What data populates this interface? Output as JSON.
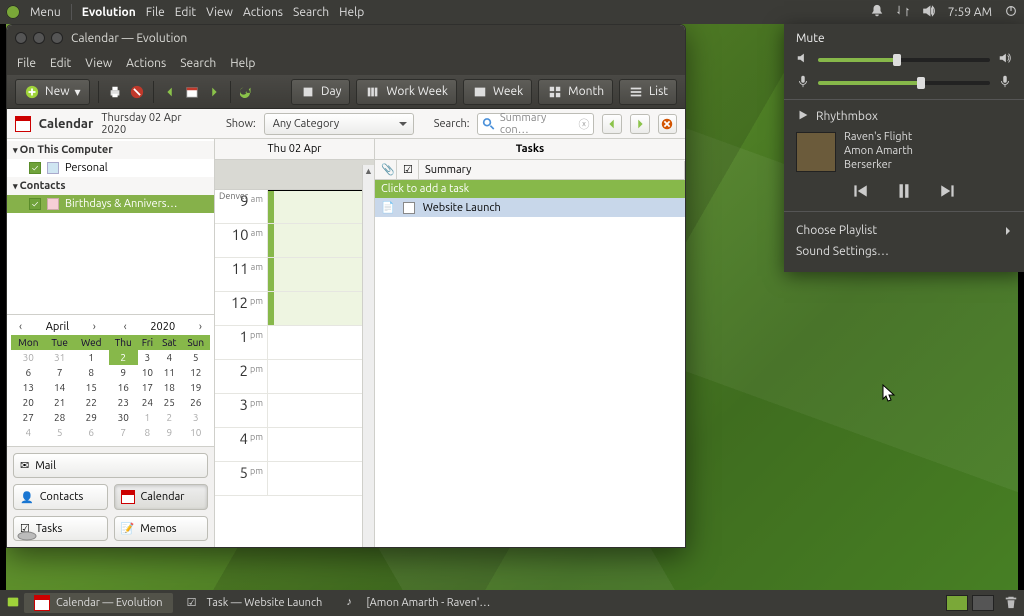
{
  "top_panel": {
    "menu": "Menu",
    "app": "Evolution",
    "items": [
      "File",
      "Edit",
      "View",
      "Actions",
      "Search",
      "Help"
    ],
    "time": "7:59 AM"
  },
  "volume_popover": {
    "mute": "Mute",
    "output_pct": 46,
    "input_pct": 60,
    "player": "Rhythmbox",
    "track": "Raven's Flight",
    "artist": "Amon Amarth",
    "album": "Berserker",
    "choose_playlist": "Choose Playlist",
    "sound_settings": "Sound Settings…"
  },
  "window": {
    "title": "Calendar — Evolution",
    "menubar": [
      "File",
      "Edit",
      "View",
      "Actions",
      "Search",
      "Help"
    ],
    "new_label": "New",
    "views": {
      "day": "Day",
      "work_week": "Work Week",
      "week": "Week",
      "month": "Month",
      "list": "List"
    }
  },
  "filter": {
    "heading": "Calendar",
    "date": "Thursday 02 Apr 2020",
    "show_label": "Show:",
    "category": "Any Category",
    "search_label": "Search:",
    "search_placeholder": "Summary con…"
  },
  "tree": {
    "computer": "On This Computer",
    "personal": "Personal",
    "contacts": "Contacts",
    "birthdays": "Birthdays & Annivers…"
  },
  "minical": {
    "month": "April",
    "year": "2020",
    "dow": [
      "Mon",
      "Tue",
      "Wed",
      "Thu",
      "Fri",
      "Sat",
      "Sun"
    ],
    "weeks": [
      [
        {
          "d": 30,
          "dim": true
        },
        {
          "d": 31,
          "dim": true
        },
        {
          "d": 1
        },
        {
          "d": 2,
          "today": true
        },
        {
          "d": 3
        },
        {
          "d": 4
        },
        {
          "d": 5
        }
      ],
      [
        {
          "d": 6
        },
        {
          "d": 7
        },
        {
          "d": 8
        },
        {
          "d": 9
        },
        {
          "d": 10
        },
        {
          "d": 11
        },
        {
          "d": 12
        }
      ],
      [
        {
          "d": 13
        },
        {
          "d": 14
        },
        {
          "d": 15
        },
        {
          "d": 16
        },
        {
          "d": 17
        },
        {
          "d": 18
        },
        {
          "d": 19
        }
      ],
      [
        {
          "d": 20
        },
        {
          "d": 21
        },
        {
          "d": 22
        },
        {
          "d": 23
        },
        {
          "d": 24
        },
        {
          "d": 25
        },
        {
          "d": 26
        }
      ],
      [
        {
          "d": 27
        },
        {
          "d": 28
        },
        {
          "d": 29
        },
        {
          "d": 30
        },
        {
          "d": 1,
          "dim": true
        },
        {
          "d": 2,
          "dim": true
        },
        {
          "d": 3,
          "dim": true
        }
      ],
      [
        {
          "d": 4,
          "dim": true
        },
        {
          "d": 5,
          "dim": true
        },
        {
          "d": 6,
          "dim": true
        },
        {
          "d": 7,
          "dim": true
        },
        {
          "d": 8,
          "dim": true
        },
        {
          "d": 9,
          "dim": true
        },
        {
          "d": 10,
          "dim": true
        }
      ]
    ]
  },
  "switcher": {
    "mail": "Mail",
    "contacts": "Contacts",
    "calendar": "Calendar",
    "tasks": "Tasks",
    "memos": "Memos"
  },
  "dayview": {
    "header": "Thu 02 Apr",
    "tz": "Denver",
    "hours": [
      {
        "h": "9",
        "ap": "am"
      },
      {
        "h": "10",
        "ap": "am"
      },
      {
        "h": "11",
        "ap": "am"
      },
      {
        "h": "12",
        "ap": "pm"
      },
      {
        "h": "1",
        "ap": "pm"
      },
      {
        "h": "2",
        "ap": "pm"
      },
      {
        "h": "3",
        "ap": "pm"
      },
      {
        "h": "4",
        "ap": "pm"
      },
      {
        "h": "5",
        "ap": "pm"
      }
    ]
  },
  "tasks": {
    "title": "Tasks",
    "summary_col": "Summary",
    "add_hint": "Click to add a task",
    "items": [
      {
        "summary": "Website Launch"
      }
    ]
  },
  "bottom": {
    "t1": "Calendar — Evolution",
    "t2": "Task — Website Launch",
    "t3": "[Amon Amarth - Raven'…"
  }
}
